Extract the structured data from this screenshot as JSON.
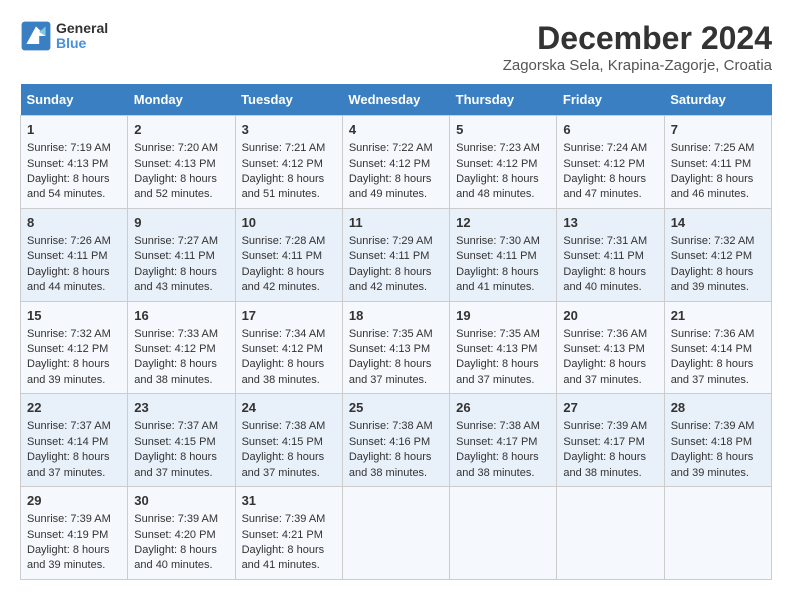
{
  "header": {
    "logo_line1": "General",
    "logo_line2": "Blue",
    "title": "December 2024",
    "subtitle": "Zagorska Sela, Krapina-Zagorje, Croatia"
  },
  "days_of_week": [
    "Sunday",
    "Monday",
    "Tuesday",
    "Wednesday",
    "Thursday",
    "Friday",
    "Saturday"
  ],
  "weeks": [
    [
      {
        "day": 1,
        "lines": [
          "Sunrise: 7:19 AM",
          "Sunset: 4:13 PM",
          "Daylight: 8 hours",
          "and 54 minutes."
        ]
      },
      {
        "day": 2,
        "lines": [
          "Sunrise: 7:20 AM",
          "Sunset: 4:13 PM",
          "Daylight: 8 hours",
          "and 52 minutes."
        ]
      },
      {
        "day": 3,
        "lines": [
          "Sunrise: 7:21 AM",
          "Sunset: 4:12 PM",
          "Daylight: 8 hours",
          "and 51 minutes."
        ]
      },
      {
        "day": 4,
        "lines": [
          "Sunrise: 7:22 AM",
          "Sunset: 4:12 PM",
          "Daylight: 8 hours",
          "and 49 minutes."
        ]
      },
      {
        "day": 5,
        "lines": [
          "Sunrise: 7:23 AM",
          "Sunset: 4:12 PM",
          "Daylight: 8 hours",
          "and 48 minutes."
        ]
      },
      {
        "day": 6,
        "lines": [
          "Sunrise: 7:24 AM",
          "Sunset: 4:12 PM",
          "Daylight: 8 hours",
          "and 47 minutes."
        ]
      },
      {
        "day": 7,
        "lines": [
          "Sunrise: 7:25 AM",
          "Sunset: 4:11 PM",
          "Daylight: 8 hours",
          "and 46 minutes."
        ]
      }
    ],
    [
      {
        "day": 8,
        "lines": [
          "Sunrise: 7:26 AM",
          "Sunset: 4:11 PM",
          "Daylight: 8 hours",
          "and 44 minutes."
        ]
      },
      {
        "day": 9,
        "lines": [
          "Sunrise: 7:27 AM",
          "Sunset: 4:11 PM",
          "Daylight: 8 hours",
          "and 43 minutes."
        ]
      },
      {
        "day": 10,
        "lines": [
          "Sunrise: 7:28 AM",
          "Sunset: 4:11 PM",
          "Daylight: 8 hours",
          "and 42 minutes."
        ]
      },
      {
        "day": 11,
        "lines": [
          "Sunrise: 7:29 AM",
          "Sunset: 4:11 PM",
          "Daylight: 8 hours",
          "and 42 minutes."
        ]
      },
      {
        "day": 12,
        "lines": [
          "Sunrise: 7:30 AM",
          "Sunset: 4:11 PM",
          "Daylight: 8 hours",
          "and 41 minutes."
        ]
      },
      {
        "day": 13,
        "lines": [
          "Sunrise: 7:31 AM",
          "Sunset: 4:11 PM",
          "Daylight: 8 hours",
          "and 40 minutes."
        ]
      },
      {
        "day": 14,
        "lines": [
          "Sunrise: 7:32 AM",
          "Sunset: 4:12 PM",
          "Daylight: 8 hours",
          "and 39 minutes."
        ]
      }
    ],
    [
      {
        "day": 15,
        "lines": [
          "Sunrise: 7:32 AM",
          "Sunset: 4:12 PM",
          "Daylight: 8 hours",
          "and 39 minutes."
        ]
      },
      {
        "day": 16,
        "lines": [
          "Sunrise: 7:33 AM",
          "Sunset: 4:12 PM",
          "Daylight: 8 hours",
          "and 38 minutes."
        ]
      },
      {
        "day": 17,
        "lines": [
          "Sunrise: 7:34 AM",
          "Sunset: 4:12 PM",
          "Daylight: 8 hours",
          "and 38 minutes."
        ]
      },
      {
        "day": 18,
        "lines": [
          "Sunrise: 7:35 AM",
          "Sunset: 4:13 PM",
          "Daylight: 8 hours",
          "and 37 minutes."
        ]
      },
      {
        "day": 19,
        "lines": [
          "Sunrise: 7:35 AM",
          "Sunset: 4:13 PM",
          "Daylight: 8 hours",
          "and 37 minutes."
        ]
      },
      {
        "day": 20,
        "lines": [
          "Sunrise: 7:36 AM",
          "Sunset: 4:13 PM",
          "Daylight: 8 hours",
          "and 37 minutes."
        ]
      },
      {
        "day": 21,
        "lines": [
          "Sunrise: 7:36 AM",
          "Sunset: 4:14 PM",
          "Daylight: 8 hours",
          "and 37 minutes."
        ]
      }
    ],
    [
      {
        "day": 22,
        "lines": [
          "Sunrise: 7:37 AM",
          "Sunset: 4:14 PM",
          "Daylight: 8 hours",
          "and 37 minutes."
        ]
      },
      {
        "day": 23,
        "lines": [
          "Sunrise: 7:37 AM",
          "Sunset: 4:15 PM",
          "Daylight: 8 hours",
          "and 37 minutes."
        ]
      },
      {
        "day": 24,
        "lines": [
          "Sunrise: 7:38 AM",
          "Sunset: 4:15 PM",
          "Daylight: 8 hours",
          "and 37 minutes."
        ]
      },
      {
        "day": 25,
        "lines": [
          "Sunrise: 7:38 AM",
          "Sunset: 4:16 PM",
          "Daylight: 8 hours",
          "and 38 minutes."
        ]
      },
      {
        "day": 26,
        "lines": [
          "Sunrise: 7:38 AM",
          "Sunset: 4:17 PM",
          "Daylight: 8 hours",
          "and 38 minutes."
        ]
      },
      {
        "day": 27,
        "lines": [
          "Sunrise: 7:39 AM",
          "Sunset: 4:17 PM",
          "Daylight: 8 hours",
          "and 38 minutes."
        ]
      },
      {
        "day": 28,
        "lines": [
          "Sunrise: 7:39 AM",
          "Sunset: 4:18 PM",
          "Daylight: 8 hours",
          "and 39 minutes."
        ]
      }
    ],
    [
      {
        "day": 29,
        "lines": [
          "Sunrise: 7:39 AM",
          "Sunset: 4:19 PM",
          "Daylight: 8 hours",
          "and 39 minutes."
        ]
      },
      {
        "day": 30,
        "lines": [
          "Sunrise: 7:39 AM",
          "Sunset: 4:20 PM",
          "Daylight: 8 hours",
          "and 40 minutes."
        ]
      },
      {
        "day": 31,
        "lines": [
          "Sunrise: 7:39 AM",
          "Sunset: 4:21 PM",
          "Daylight: 8 hours",
          "and 41 minutes."
        ]
      },
      null,
      null,
      null,
      null
    ]
  ]
}
